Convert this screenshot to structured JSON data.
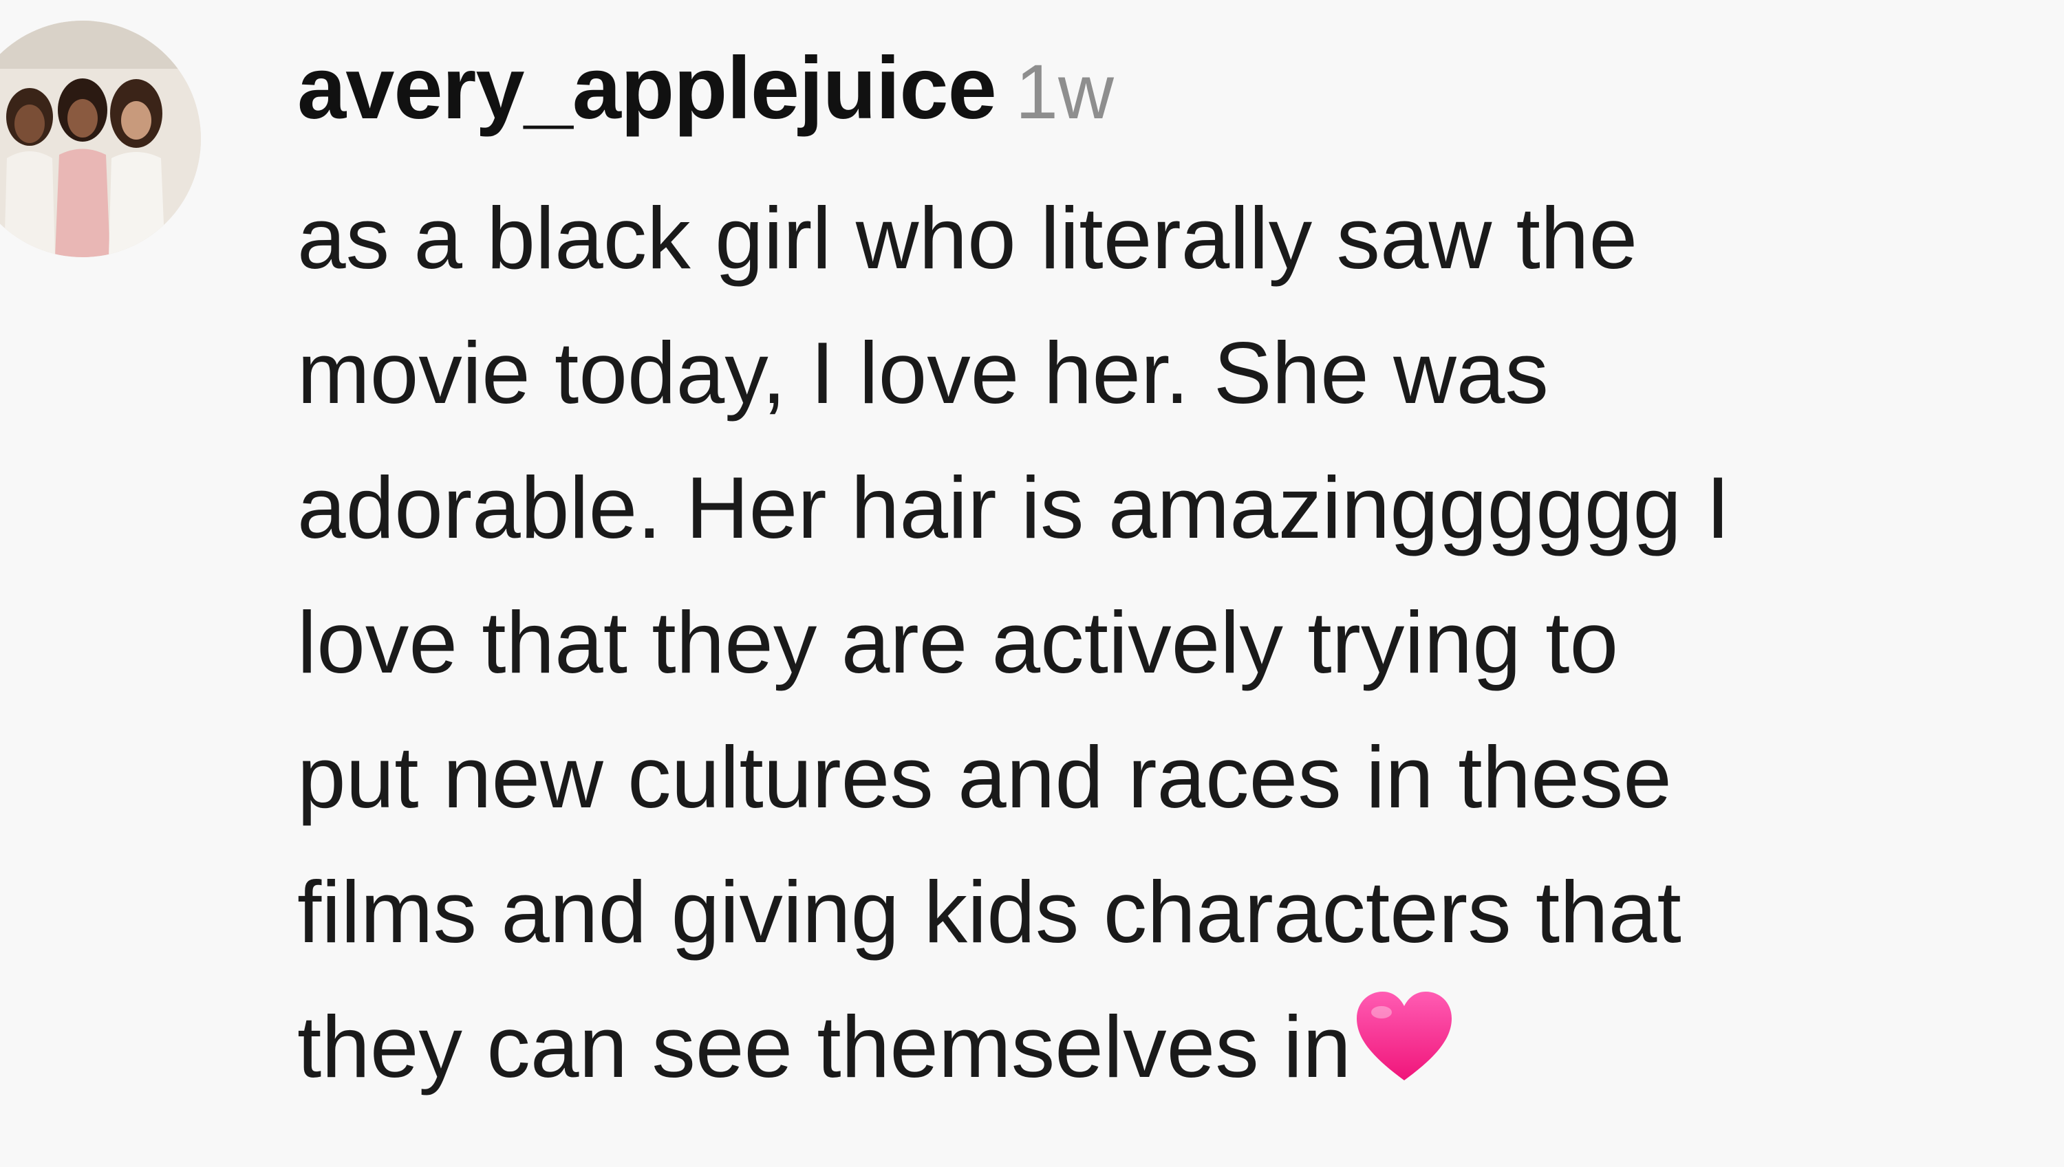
{
  "comment": {
    "username": "avery_applejuice",
    "timestamp": "1w",
    "text_lines": [
      "as a black girl who literally saw the",
      "movie today, I love her. She was",
      "adorable. Her hair is amazingggggg I",
      "love that they are actively trying to",
      "put new cultures and races in these",
      "films and giving kids characters that",
      "they can see themselves in"
    ],
    "trailing_emoji": "heart-icon"
  },
  "colors": {
    "background": "#f8f8f8",
    "username": "#111111",
    "timestamp": "#8e8e8e",
    "heart": "#ff2d8f"
  }
}
